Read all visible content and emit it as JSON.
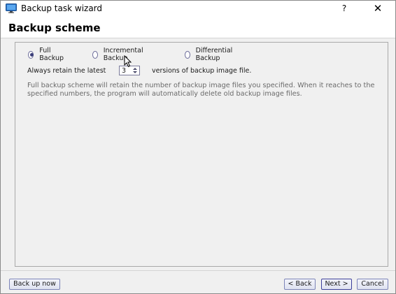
{
  "window": {
    "title": "Backup task wizard",
    "help_label": "?",
    "close_label": "✕"
  },
  "header": {
    "title": "Backup scheme"
  },
  "scheme": {
    "options": [
      {
        "label": "Full Backup",
        "selected": true
      },
      {
        "label": "Incremental Backup",
        "selected": false
      },
      {
        "label": "Differential Backup",
        "selected": false
      }
    ],
    "retain_prefix": "Always retain the latest",
    "retain_value": "3",
    "retain_suffix": "versions of backup image file.",
    "description": "Full backup scheme will retain the number of backup image files you specified. When it reaches to the specified numbers, the program will automatically delete old backup image files."
  },
  "footer": {
    "backup_now_label": "Back up now",
    "back_label": "< Back",
    "next_label": "Next >",
    "cancel_label": "Cancel"
  },
  "colors": {
    "accent": "#3c3f7a",
    "button_border": "#7c84b8",
    "description_text": "#6a6a6a"
  },
  "icons": [
    "monitor-app-icon",
    "radio-button-icon",
    "spinner-arrows-icon",
    "mouse-cursor-icon"
  ]
}
